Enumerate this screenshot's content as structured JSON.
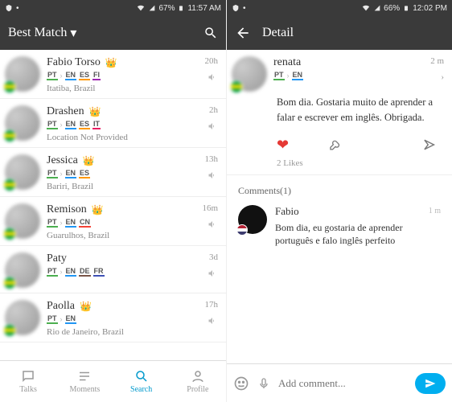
{
  "left": {
    "status": {
      "battery": "67%",
      "time": "11:57 AM"
    },
    "title": "Best Match",
    "list": [
      {
        "name": "Fabio Torso",
        "crown": true,
        "langs": [
          "PT",
          "EN",
          "ES",
          "FI"
        ],
        "loc": "Itatiba, Brazil",
        "time": "20h"
      },
      {
        "name": "Drashen",
        "crown": true,
        "langs": [
          "PT",
          "EN",
          "ES",
          "IT"
        ],
        "loc": "Location Not Provided",
        "time": "2h"
      },
      {
        "name": "Jessica",
        "crown": true,
        "langs": [
          "PT",
          "EN",
          "ES"
        ],
        "loc": "Bariri, Brazil",
        "time": "13h"
      },
      {
        "name": "Remison",
        "crown": true,
        "langs": [
          "PT",
          "EN",
          "CN"
        ],
        "loc": "Guarulhos, Brazil",
        "time": "16m"
      },
      {
        "name": "Paty",
        "crown": false,
        "langs": [
          "PT",
          "EN",
          "DE",
          "FR"
        ],
        "loc": "",
        "time": "3d"
      },
      {
        "name": "Paolla",
        "crown": true,
        "langs": [
          "PT",
          "EN"
        ],
        "loc": "Rio de Janeiro, Brazil",
        "time": "17h"
      }
    ],
    "nav": [
      {
        "label": "Talks"
      },
      {
        "label": "Moments"
      },
      {
        "label": "Search"
      },
      {
        "label": "Profile"
      }
    ]
  },
  "right": {
    "status": {
      "battery": "66%",
      "time": "12:02 PM"
    },
    "title": "Detail",
    "post": {
      "author": "renata",
      "langs": [
        "PT",
        "EN"
      ],
      "time": "2 m",
      "body": "Bom dia. Gostaria muito de aprender a falar e escrever em inglês. Obrigada.",
      "likes": "2 Likes"
    },
    "commentsHeader": "Comments(1)",
    "comments": [
      {
        "author": "Fabio",
        "time": "1 m",
        "body": "Bom dia, eu gostaria de aprender português e falo inglês perfeito"
      }
    ],
    "input": {
      "placeholder": "Add comment..."
    }
  }
}
